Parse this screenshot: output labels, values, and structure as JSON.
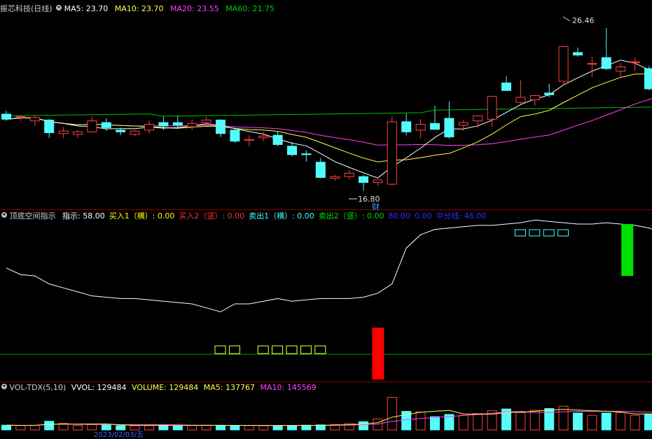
{
  "colors": {
    "up": "#ff4040",
    "down": "#54fcfc",
    "ma5": "#ffffff",
    "ma10": "#ffff50",
    "ma20": "#ff40ff",
    "ma60": "#00c000",
    "grid": "#7a0000",
    "indicator_line": "#ffffff",
    "mid_line": "#00a000",
    "buy_bar": "#ff0000",
    "sell_bar": "#00e000"
  },
  "price_pane": {
    "title": "振芯科技(日线)",
    "ma5_label": "MA5: 23.70",
    "ma10_label": "MA10: 23.70",
    "ma20_label": "MA20: 23.55",
    "ma60_label": "MA60: 21.75",
    "high_label": "26.46",
    "low_label": "16.80",
    "fin_marker": "财",
    "chart_data": {
      "type": "candlestick",
      "ylim": [
        16.0,
        27.2
      ],
      "ohlc": [
        [
          21.35,
          21.55,
          20.95,
          21.05
        ],
        [
          21.15,
          21.3,
          20.95,
          21.2
        ],
        [
          20.95,
          21.3,
          20.65,
          21.15
        ],
        [
          21.0,
          21.05,
          19.95,
          20.25
        ],
        [
          20.2,
          20.6,
          19.95,
          20.35
        ],
        [
          20.15,
          20.4,
          19.95,
          20.3
        ],
        [
          20.3,
          21.2,
          20.25,
          20.95
        ],
        [
          20.85,
          21.1,
          20.35,
          20.55
        ],
        [
          20.4,
          20.55,
          20.1,
          20.3
        ],
        [
          20.15,
          20.4,
          20.05,
          20.35
        ],
        [
          20.4,
          20.95,
          20.2,
          20.75
        ],
        [
          20.85,
          21.2,
          20.4,
          20.65
        ],
        [
          20.85,
          21.25,
          20.55,
          20.7
        ],
        [
          20.6,
          21.05,
          20.4,
          20.8
        ],
        [
          20.85,
          21.2,
          20.7,
          21.0
        ],
        [
          21.0,
          21.05,
          20.0,
          20.2
        ],
        [
          20.4,
          20.55,
          19.65,
          19.75
        ],
        [
          19.8,
          20.1,
          19.45,
          19.85
        ],
        [
          19.95,
          20.3,
          19.75,
          20.05
        ],
        [
          20.1,
          20.35,
          19.45,
          19.55
        ],
        [
          19.45,
          19.7,
          18.85,
          18.95
        ],
        [
          19.0,
          19.2,
          18.55,
          18.95
        ],
        [
          18.5,
          18.75,
          17.55,
          17.6
        ],
        [
          17.55,
          17.75,
          17.4,
          17.65
        ],
        [
          17.65,
          18.05,
          17.5,
          17.85
        ],
        [
          17.65,
          17.75,
          16.8,
          17.3
        ],
        [
          17.3,
          17.45,
          17.1,
          17.45
        ],
        [
          17.2,
          21.2,
          17.15,
          20.9
        ],
        [
          20.9,
          21.4,
          20.1,
          20.3
        ],
        [
          20.4,
          21.05,
          19.95,
          20.75
        ],
        [
          20.8,
          21.85,
          20.55,
          20.45
        ],
        [
          21.1,
          22.1,
          19.9,
          20.0
        ],
        [
          20.7,
          21.0,
          20.35,
          20.85
        ],
        [
          20.95,
          21.25,
          20.55,
          21.25
        ],
        [
          21.05,
          22.45,
          20.6,
          22.4
        ],
        [
          23.2,
          23.6,
          22.8,
          22.75
        ],
        [
          22.05,
          23.35,
          21.95,
          22.35
        ],
        [
          22.2,
          22.5,
          21.85,
          22.45
        ],
        [
          22.6,
          23.15,
          22.35,
          22.5
        ],
        [
          23.3,
          24.3,
          23.05,
          25.35
        ],
        [
          25.0,
          25.3,
          24.75,
          24.85
        ],
        [
          24.35,
          24.75,
          23.55,
          24.35
        ],
        [
          24.7,
          26.46,
          23.95,
          24.05
        ],
        [
          23.9,
          24.4,
          23.55,
          24.15
        ],
        [
          24.45,
          24.7,
          23.9,
          24.45
        ],
        [
          24.05,
          24.2,
          22.75,
          22.85
        ],
        [
          23.2,
          23.5,
          22.35,
          22.55
        ],
        [
          22.6,
          22.9,
          22.15,
          22.55
        ],
        [
          22.65,
          22.95,
          22.3,
          22.85
        ]
      ]
    }
  },
  "indicator_pane": {
    "title": "顶底空间指示",
    "items": [
      {
        "text": "指示: 58.00",
        "color": "#ffffff"
      },
      {
        "text": "买入1（横）: 0.00",
        "color": "#ffff00"
      },
      {
        "text": "买入2（竖）: 0.00",
        "color": "#ff3030"
      },
      {
        "text": "卖出1（横）: 0.00",
        "color": "#40ffff"
      },
      {
        "text": "卖出2（竖）: 0.00",
        "color": "#00e000"
      },
      {
        "text": "80.00",
        "color": "#3030ff"
      },
      {
        "text": "0.00",
        "color": "#3030ff"
      },
      {
        "text": "中分线: 46.00",
        "color": "#3030ff"
      }
    ],
    "chart_data": {
      "type": "line",
      "ylim": [
        0,
        100
      ],
      "mid_line": 46,
      "values": [
        67,
        62,
        61,
        55,
        52,
        49,
        46,
        45,
        44,
        44,
        43,
        42,
        41,
        40,
        37,
        34,
        40,
        40,
        42,
        44,
        42,
        43,
        44,
        44,
        44,
        45,
        48,
        55,
        82,
        92,
        96,
        97,
        98,
        99,
        99,
        100,
        101,
        103,
        102,
        101,
        100,
        100,
        101,
        100,
        99,
        97,
        93,
        88,
        84
      ],
      "buy_marks_horizontal": [
        15,
        16,
        18,
        19,
        20,
        21,
        22
      ],
      "sell_marks_horizontal": [
        36,
        37,
        38,
        39
      ],
      "buy_bar_index": 26,
      "sell_bar_index": 43
    }
  },
  "volume_pane": {
    "title": "VOL-TDX(5,10)",
    "vvol_label": "VVOL: 129484",
    "volume_label": "VOLUME: 129484",
    "ma5_label": "MA5: 137767",
    "ma10_label": "MA10: 145569",
    "date_partial": "2023/02/03/五",
    "chart_data": {
      "type": "bar",
      "values": [
        52000,
        48000,
        51000,
        95000,
        72000,
        48000,
        58000,
        55000,
        47000,
        46000,
        47000,
        55000,
        46000,
        51000,
        52000,
        50000,
        49000,
        48000,
        46000,
        47000,
        50000,
        52000,
        55000,
        60000,
        70000,
        90000,
        121000,
        358000,
        204000,
        197000,
        145000,
        170000,
        160000,
        180000,
        210000,
        230000,
        190000,
        215000,
        235000,
        260000,
        185000,
        160000,
        185000,
        190000,
        160000,
        175000,
        140000,
        125000,
        129484
      ],
      "ylim": [
        0,
        400000
      ]
    }
  }
}
